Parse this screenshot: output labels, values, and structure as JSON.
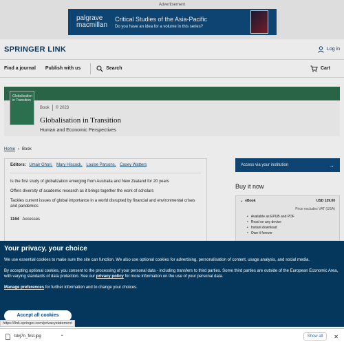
{
  "ad": {
    "label": "Advertisement",
    "brand_line1": "palgrave",
    "brand_line2": "macmillan",
    "title": "Critical Studies of the Asia-Pacific",
    "subtitle": "Do you have an idea for a volume in this series?"
  },
  "header": {
    "logo": "SPRINGER LINK",
    "login": "Log in"
  },
  "nav": {
    "find_journal": "Find a journal",
    "publish": "Publish with us",
    "search": "Search",
    "cart": "Cart"
  },
  "book": {
    "cover_title": "Globalisation in Transition",
    "type": "Book",
    "year": "© 2023",
    "title": "Globalisation in Transition",
    "subtitle": "Human and Economic Perspectives"
  },
  "breadcrumb": {
    "home": "Home",
    "current": "Book"
  },
  "info": {
    "editors_label": "Editors:",
    "editors": [
      "Umair Ghori,",
      "Mary Hiscock,",
      "Louise Parsons,",
      "Casey Watters"
    ],
    "bullets": [
      "Is the first study of globalization emerging from Australia and New Zealand for 20 years",
      "Offers diversity of academic research as it brings together the work of scholars",
      "Tackles current issues of global importance in a world disrupted by financial and environmental crises and pandemics"
    ],
    "accesses_count": "1164",
    "accesses_label": "Accesses"
  },
  "purchase": {
    "access_button": "Access via your institution",
    "buy_now": "Buy it now",
    "format": "eBook",
    "price": "USD 139.00",
    "vat": "Price excludes VAT (USA)",
    "features": [
      "Available as EPUB and PDF",
      "Read on any device",
      "Instant download",
      "Own it forever"
    ]
  },
  "cookie": {
    "title": "Your privacy, your choice",
    "p1": "We use essential cookies to make sure the site can function. We also use optional cookies for advertising, personalisation of content, usage analysis, and social media.",
    "p2_start": "By accepting optional cookies, you consent to the processing of your personal data - including transfers to third parties. Some third parties are outside of the European Economic Area, with varying standards of data protection. See our ",
    "privacy_link": "privacy policy",
    "p2_end": " for more information on the use of your personal data.",
    "manage_link": "Manage preferences",
    "p3_end": " for further information and to change your choices.",
    "accept": "Accept all cookies"
  },
  "status_url": "https://link.springer.com/privacystatement",
  "downloads": {
    "file": "tdvj7n_first.jpg",
    "show_all": "Show all"
  },
  "colors": {
    "brand_blue": "#0f4a7c",
    "cookie_bg": "#04375b",
    "book_green": "#2e6d4e"
  }
}
